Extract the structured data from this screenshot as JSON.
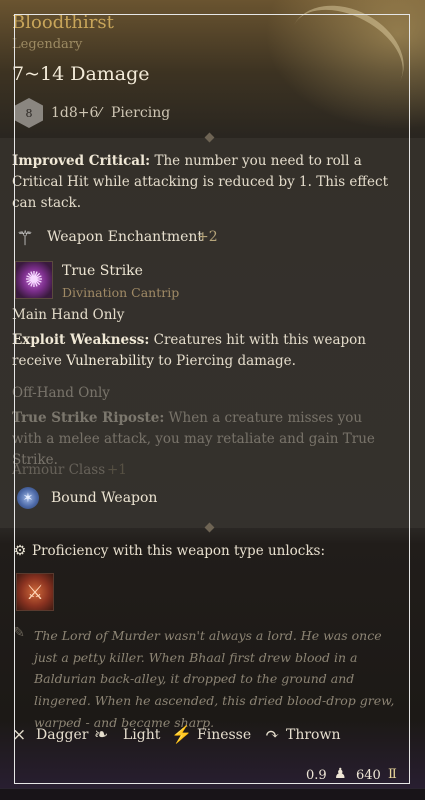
{
  "item": {
    "name": "Bloodthirst",
    "rarity": "Legendary",
    "damage": "7~14 Damage",
    "die": "8",
    "roll": "1d8+6",
    "damage_type": "Piercing"
  },
  "improved_critical": {
    "label": "Improved Critical:",
    "text": "The number you need to roll a Critical Hit while attacking is reduced by 1. This effect can stack."
  },
  "enchantment": {
    "label": "Weapon Enchantment",
    "bonus": "+2"
  },
  "spell": {
    "name": "True Strike",
    "school": "Divination Cantrip"
  },
  "main_hand": {
    "label": "Main Hand Only",
    "exploit_label": "Exploit Weakness:",
    "exploit_text_1": "Creatures hit with this weapon",
    "exploit_text_2_pre": "receive",
    "exploit_text_2_hl": "Vulnerability",
    "exploit_text_2_post": "to Piercing damage."
  },
  "off_hand": {
    "label": "Off-Hand Only",
    "riposte_label": "True Strike Riposte:",
    "riposte_text": "When a creature misses you with a melee attack, you may retaliate and gain True Strike."
  },
  "armour": {
    "label": "Armour Class",
    "bonus": "+1"
  },
  "bound": {
    "label": "Bound Weapon"
  },
  "proficiency": {
    "label": "Proficiency with this weapon type unlocks:"
  },
  "lore": "The Lord of Murder wasn't always a lord. He was once just a petty killer. When Bhaal first drew blood in a Baldurian back-alley, it dropped to the ground and lingered. When he ascended, this dried blood-drop grew, warped - and became sharp.",
  "properties": [
    "Dagger",
    "Light",
    "Finesse",
    "Thrown"
  ],
  "footer": {
    "weight": "0.9",
    "value": "640"
  },
  "icons": {
    "die": "d8-die-icon",
    "damage_type": "dagger-piercing-icon",
    "enchantment": "enchantment-icon",
    "spell": "true-strike-icon",
    "bound": "bound-weapon-icon",
    "proficiency": "proficiency-icon",
    "proficiency_action": "weapon-action-icon",
    "lore": "lore-feather-icon",
    "dagger": "dagger-icon",
    "light": "feather-light-icon",
    "finesse": "finesse-icon",
    "thrown": "thrown-icon",
    "weight": "weight-icon",
    "gold": "gold-icon"
  },
  "colors": {
    "title": "#c8a55a",
    "rarity": "#9c8a62",
    "bonus": "#b5a47a"
  }
}
